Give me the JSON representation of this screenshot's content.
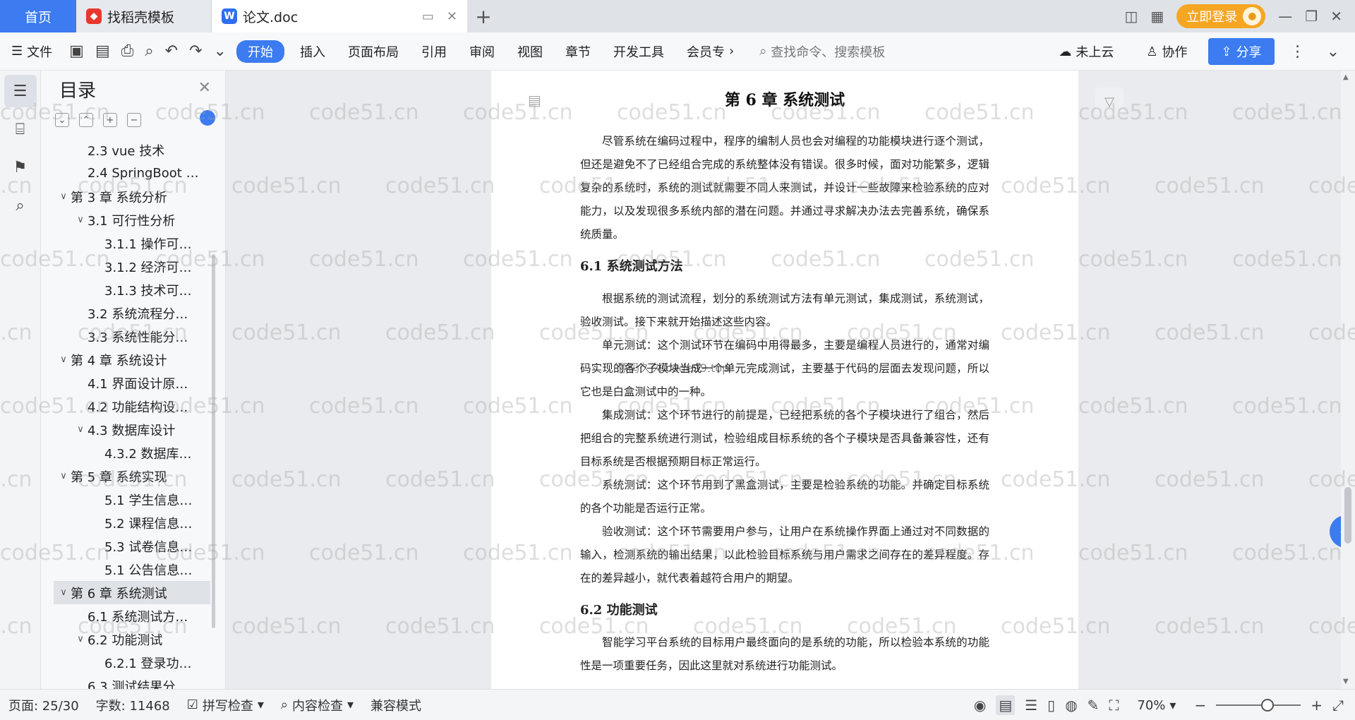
{
  "tabs": {
    "home": "首页",
    "template": "找稻壳模板",
    "doc": "论文.doc",
    "login": "立即登录"
  },
  "ribbon": {
    "file": "文件",
    "start": "开始",
    "insert": "插入",
    "layout": "页面布局",
    "reference": "引用",
    "review": "审阅",
    "view": "视图",
    "chapter": "章节",
    "devtools": "开发工具",
    "member": "会员专",
    "search": "查找命令、搜索模板",
    "cloud": "未上云",
    "collab": "协作",
    "share": "分享"
  },
  "toc": {
    "title": "目录",
    "items": [
      {
        "label": "2.3 vue 技术",
        "level": 2,
        "caret": ""
      },
      {
        "label": "2.4 SpringBoot …",
        "level": 2,
        "caret": ""
      },
      {
        "label": "第 3 章  系统分析",
        "level": 1,
        "caret": "∨"
      },
      {
        "label": "3.1 可行性分析",
        "level": 2,
        "caret": "∨"
      },
      {
        "label": "3.1.1 操作可…",
        "level": 3,
        "caret": ""
      },
      {
        "label": "3.1.2 经济可…",
        "level": 3,
        "caret": ""
      },
      {
        "label": "3.1.3 技术可…",
        "level": 3,
        "caret": ""
      },
      {
        "label": "3.2 系统流程分…",
        "level": 2,
        "caret": ""
      },
      {
        "label": "3.3 系统性能分…",
        "level": 2,
        "caret": ""
      },
      {
        "label": "第 4 章  系统设计",
        "level": 1,
        "caret": "∨"
      },
      {
        "label": "4.1 界面设计原…",
        "level": 2,
        "caret": ""
      },
      {
        "label": "4.2 功能结构设…",
        "level": 2,
        "caret": ""
      },
      {
        "label": "4.3 数据库设计",
        "level": 2,
        "caret": "∨"
      },
      {
        "label": "4.3.2  数据库…",
        "level": 3,
        "caret": ""
      },
      {
        "label": "第 5 章  系统实现",
        "level": 1,
        "caret": "∨"
      },
      {
        "label": "5.1 学生信息…",
        "level": 3,
        "caret": ""
      },
      {
        "label": "5.2  课程信息…",
        "level": 3,
        "caret": ""
      },
      {
        "label": "5.3 试卷信息…",
        "level": 3,
        "caret": ""
      },
      {
        "label": "5.1 公告信息…",
        "level": 3,
        "caret": ""
      },
      {
        "label": "第 6 章  系统测试",
        "level": 1,
        "caret": "∨",
        "selected": true
      },
      {
        "label": "6.1  系统测试方…",
        "level": 2,
        "caret": ""
      },
      {
        "label": "6.2  功能测试",
        "level": 2,
        "caret": "∨"
      },
      {
        "label": "6.2.1  登录功…",
        "level": 3,
        "caret": ""
      },
      {
        "label": "6.3 测试结果分…",
        "level": 2,
        "caret": ""
      }
    ]
  },
  "document": {
    "title": "第 6 章  系统测试",
    "p1": "尽管系统在编码过程中，程序的编制人员也会对编程的功能模块进行逐个测试，但还是避免不了已经组合完成的系统整体没有错误。很多时候，面对功能繁多，逻辑复杂的系统时，系统的测试就需要不同人来测试，并设计一些故障来检验系统的应对能力，以及发现很多系统内部的潜在问题。并通过寻求解决办法去完善系统，确保系统质量。",
    "h61": "6.1  系统测试方法",
    "p2": "根据系统的测试流程，划分的系统测试方法有单元测试，集成测试，系统测试，验收测试。接下来就开始描述这些内容。",
    "p3": "单元测试：这个测试环节在编码中用得最多，主要是编程人员进行的，通常对编码实现的各个子模块当成一个单元完成测试，主要基于代码的层面去发现问题，所以它也是白盒测试中的一种。",
    "p4": "集成测试：这个环节进行的前提是，已经把系统的各个子模块进行了组合，然后把组合的完整系统进行测试，检验组成目标系统的各个子模块是否具备兼容性，还有目标系统是否根据预期目标正常运行。",
    "p5": "系统测试：这个环节用到了黑盒测试，主要是检验系统的功能。并确定目标系统的各个功能是否运行正常。",
    "p6": "验收测试：这个环节需要用户参与，让用户在系统操作界面上通过对不同数据的输入，检测系统的输出结果，以此检验目标系统与用户需求之间存在的差异程度。存在的差异越小，就代表着越符合用户的期望。",
    "h62": "6.2  功能测试",
    "p7": "智能学习平台系统的目标用户最终面向的是系统的功能，所以检验本系统的功能性是一项重要任务，因此这里就对系统进行功能测试。"
  },
  "watermark": {
    "text": "code51.cn",
    "center": "源码久久 code99.top"
  },
  "status": {
    "page": "页面: 25/30",
    "words": "字数: 11468",
    "spell": "拼写检查",
    "content": "内容检查",
    "compat": "兼容模式",
    "zoom": "70%"
  },
  "colors": {
    "accent": "#3c7bf0",
    "login": "#f5a623"
  }
}
